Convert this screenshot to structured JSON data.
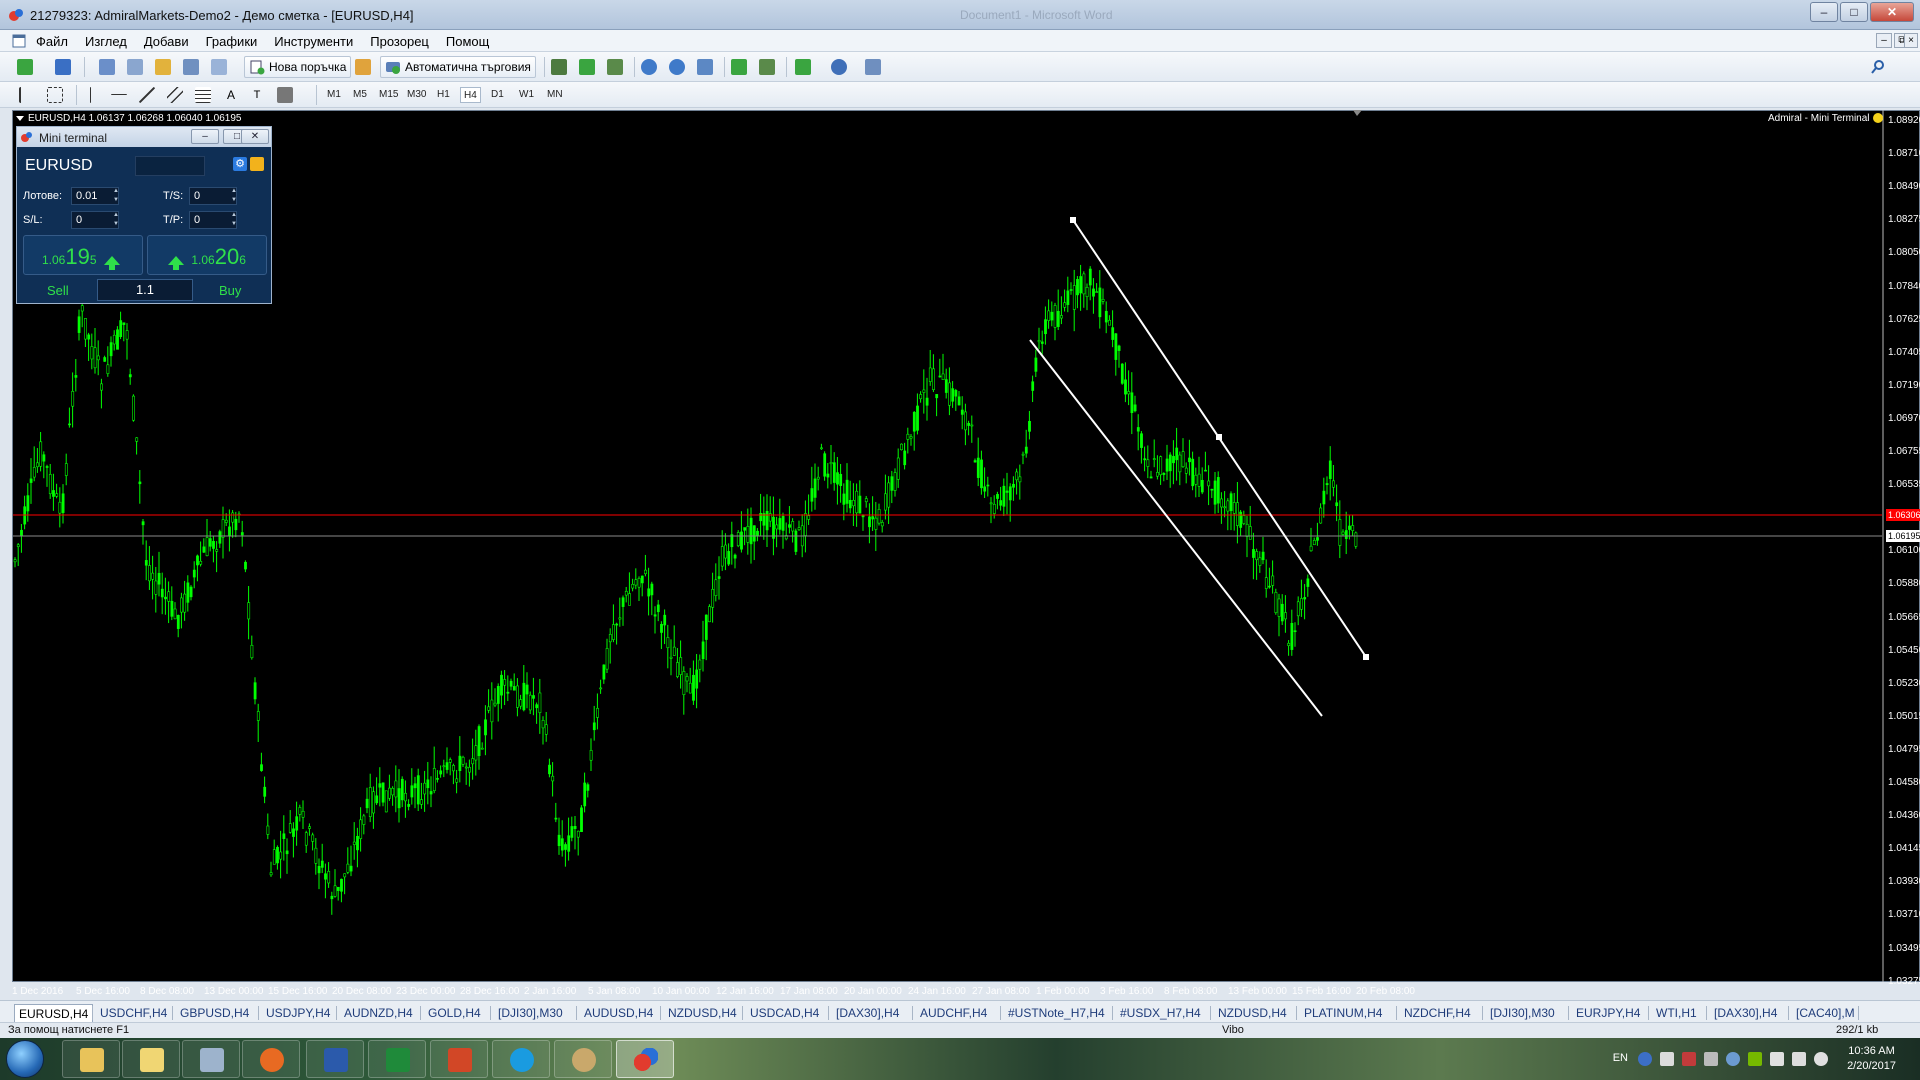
{
  "window": {
    "title": "21279323: AdmiralMarkets-Demo2 - Демо сметка - [EURUSD,H4]",
    "faded_title": "Document1 - Microsoft Word"
  },
  "menu": [
    "Файл",
    "Изглед",
    "Добави",
    "Графики",
    "Инструменти",
    "Прозорец",
    "Помощ"
  ],
  "toolbar": {
    "new_order": "Нова поръчка",
    "auto_trading": "Автоматична търговия",
    "timeframes": [
      "M1",
      "M5",
      "M15",
      "M30",
      "H1",
      "H4",
      "D1",
      "W1",
      "MN"
    ],
    "active_timeframe": "H4"
  },
  "chart": {
    "header": "EURUSD,H4  1.06137 1.06268 1.06040 1.06195",
    "ea_label": "Admiral - Mini Terminal",
    "bid_tag": "1.06195",
    "ask_tag": "1.06306",
    "price_axis": [
      "1.08920",
      "1.08710",
      "1.08490",
      "1.08275",
      "1.08050",
      "1.07840",
      "1.07625",
      "1.07405",
      "1.07190",
      "1.06970",
      "1.06755",
      "1.06535",
      "1.06315",
      "1.06100",
      "1.05880",
      "1.05665",
      "1.05450",
      "1.05230",
      "1.05015",
      "1.04795",
      "1.04580",
      "1.04360",
      "1.04145",
      "1.03930",
      "1.03710",
      "1.03495",
      "1.03275"
    ],
    "date_axis": [
      "1 Dec 2016",
      "5 Dec 16:00",
      "8 Dec 08:00",
      "13 Dec 00:00",
      "15 Dec 16:00",
      "20 Dec 08:00",
      "23 Dec 00:00",
      "28 Dec 16:00",
      "2 Jan 16:00",
      "5 Jan 08:00",
      "10 Jan 00:00",
      "12 Jan 16:00",
      "17 Jan 08:00",
      "20 Jan 00:00",
      "24 Jan 16:00",
      "27 Jan 08:00",
      "1 Feb 00:00",
      "3 Feb 16:00",
      "8 Feb 08:00",
      "13 Feb 00:00",
      "15 Feb 16:00",
      "20 Feb 08:00"
    ],
    "colors": {
      "background": "#000000",
      "candles": "#00ff00",
      "ask_line": "#ff0000",
      "bid_line": "#808080",
      "channel": "#ffffff"
    }
  },
  "mini_terminal": {
    "title": "Mini terminal",
    "symbol": "EURUSD",
    "lots_label": "Лотове:",
    "lots_value": "0.01",
    "ts_label": "T/S:",
    "ts_value": "0",
    "sl_label": "S/L:",
    "sl_value": "0",
    "tp_label": "T/P:",
    "tp_value": "0",
    "sell_price_small": "1.06",
    "sell_price_big": "19",
    "sell_price_sup": "5",
    "buy_price_small": "1.06",
    "buy_price_big": "20",
    "buy_price_sup": "6",
    "sell_label": "Sell",
    "buy_label": "Buy",
    "spread": "1.1"
  },
  "tabs": [
    "EURUSD,H4",
    "USDCHF,H4",
    "GBPUSD,H4",
    "USDJPY,H4",
    "AUDNZD,H4",
    "GOLD,H4",
    "[DJI30],M30",
    "AUDUSD,H4",
    "NZDUSD,H4",
    "USDCAD,H4",
    "[DAX30],H4",
    "AUDCHF,H4",
    "#USTNote_H7,H4",
    "#USDX_H7,H4",
    "NZDUSD,H4",
    "PLATINUM,H4",
    "NZDCHF,H4",
    "[DJI30],M30",
    "EURJPY,H4",
    "WTI,H1",
    "[DAX30],H4",
    "[CAC40],M"
  ],
  "active_tab": "EURUSD,H4",
  "status": {
    "help": "За помощ натиснете F1",
    "profile": "Vibo",
    "connection": "292/1 kb"
  },
  "taskbar": {
    "lang": "EN",
    "time": "10:36 AM",
    "date": "2/20/2017"
  }
}
